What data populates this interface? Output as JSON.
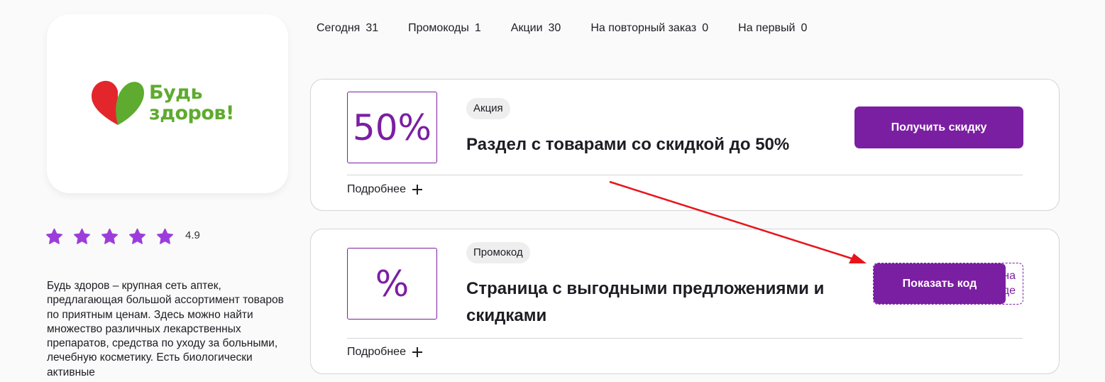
{
  "brand": {
    "logo_line1": "Будь",
    "logo_line2": "здоров!",
    "colors": {
      "logo_green": "#5eab2f",
      "logo_red": "#e3262b",
      "accent_purple": "#7b1fa2",
      "star_purple": "#9c3ddb"
    }
  },
  "rating": {
    "stars": 5,
    "value": "4.9"
  },
  "description": "Будь здоров – крупная сеть аптек, предлагающая большой ассортимент товаров по приятным ценам. Здесь можно найти множество различных лекарственных препаратов, средства по уходу за больными, лечебную косметику. Есть биологически активные",
  "tabs": [
    {
      "label": "Сегодня",
      "count": "31"
    },
    {
      "label": "Промокоды",
      "count": "1"
    },
    {
      "label": "Акции",
      "count": "30"
    },
    {
      "label": "На повторный заказ",
      "count": "0"
    },
    {
      "label": "На первый",
      "count": "0"
    }
  ],
  "offers": [
    {
      "value": "50%",
      "badge": "Акция",
      "title": "Раздел с товарами со скидкой до 50%",
      "button": "Получить скидку",
      "more": "Подробнее"
    },
    {
      "value": "%",
      "badge": "Промокод",
      "title": "Страница с выгодными предложениями и скидками",
      "button": "Показать код",
      "code_peek_line1": "на",
      "code_peek_line2": "де",
      "more": "Подробнее"
    }
  ],
  "annotation": {
    "arrow_color": "#e8141b"
  }
}
